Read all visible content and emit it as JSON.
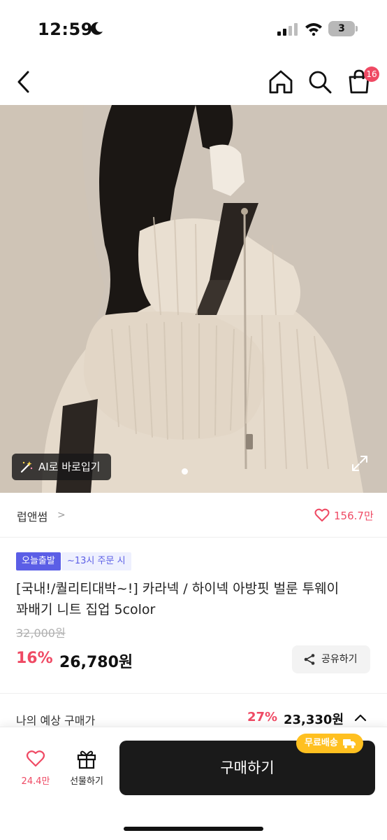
{
  "status_bar": {
    "time": "12:59",
    "battery": "3"
  },
  "nav": {
    "cart_badge": "16"
  },
  "hero": {
    "ai_button_label": "AI로 바로입기"
  },
  "brand": {
    "name": "럽앤썸",
    "chevron": ">",
    "likes": "156.7만"
  },
  "product": {
    "badge_today": "오늘출발",
    "badge_cutoff": "~13시 주문 시",
    "title": "[국내!/퀄리티대박~!] 카라넥 / 하이넥 아방핏 벌룬 투웨이 꽈배기 니트 집업 5color",
    "original_price": "32,000원",
    "discount": "16%",
    "price": "26,780원",
    "share_label": "공유하기"
  },
  "estimate": {
    "label": "나의 예상 구매가",
    "discount": "27%",
    "price": "23,330원"
  },
  "bottom": {
    "wish_count": "24.4만",
    "gift_label": "선물하기",
    "buy_label": "구매하기",
    "free_shipping": "무료배송"
  },
  "colors": {
    "accent_pink": "#ef4a64",
    "badge_blue": "#5b5ee6",
    "buy_button": "#1a1a1a",
    "free_ship_yellow": "#ffc020"
  }
}
